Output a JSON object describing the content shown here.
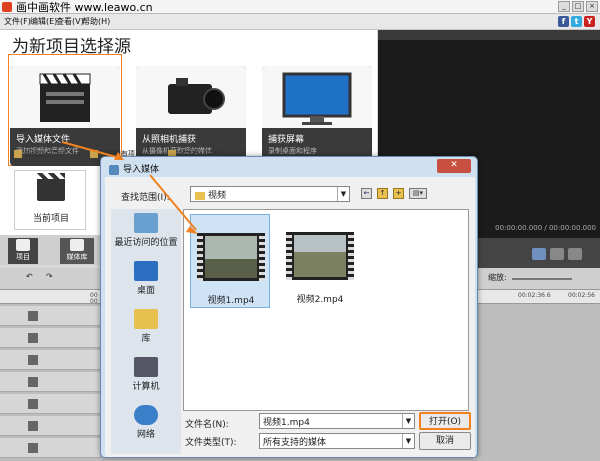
{
  "window": {
    "title": "画中画软件 www.leawo.cn",
    "controls": [
      "_",
      "□",
      "×"
    ]
  },
  "menu": {
    "items": [
      "文件(F)",
      "编辑(E)",
      "查看(V)",
      "帮助(H)"
    ],
    "social": [
      {
        "name": "facebook",
        "glyph": "f",
        "color": "#3b5998"
      },
      {
        "name": "twitter",
        "glyph": "t",
        "color": "#33aadd"
      },
      {
        "name": "youtube",
        "glyph": "Y",
        "color": "#cc2222"
      }
    ]
  },
  "source": {
    "heading": "为新项目选择源",
    "tiles": [
      {
        "title": "导入媒体文件",
        "subtitle": "添加视频和音频文件"
      },
      {
        "title": "从照相机捕获",
        "subtitle": "从摄像机获取您的媒体"
      },
      {
        "title": "捕获屏幕",
        "subtitle": "录制桌面和程序"
      }
    ],
    "actions": [
      "创建空白项目",
      "打开现有项目",
      "保存当前项目"
    ],
    "current_project": "当前项目",
    "nav": [
      "项目",
      "媒体库"
    ]
  },
  "preview": {
    "timecode": "00:00:00.000 / 00:00:00.000"
  },
  "timeline": {
    "zoom_label": "缩放:",
    "ticks_left": [
      "00",
      "00"
    ],
    "ticks_right": [
      "00:02:36.6",
      "00:02:56"
    ]
  },
  "dialog": {
    "title": "导入媒体",
    "look_in_label": "查找范围(I):",
    "look_in_value": "视频",
    "places": [
      "最近访问的位置",
      "桌面",
      "库",
      "计算机",
      "网络"
    ],
    "files": [
      {
        "name": "视频1.mp4",
        "selected": true
      },
      {
        "name": "视频2.mp4",
        "selected": false
      }
    ],
    "filename_label": "文件名(N):",
    "filename_value": "视频1.mp4",
    "filetype_label": "文件类型(T):",
    "filetype_value": "所有支持的媒体",
    "open_label": "打开(O)",
    "cancel_label": "取消"
  },
  "colors": {
    "highlight": "#f08020",
    "dialog_frame": "#cfe0f0"
  }
}
